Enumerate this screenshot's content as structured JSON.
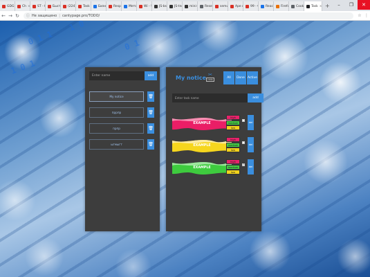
{
  "browser": {
    "tabs": [
      {
        "title": "GDG G",
        "color": "#d93025"
      },
      {
        "title": "Ch",
        "color": "#d93025"
      },
      {
        "title": "ST - fb",
        "color": "#d93025"
      },
      {
        "title": "Быстр",
        "color": "#d93025"
      },
      {
        "title": "(224) Н",
        "color": "#d93025"
      },
      {
        "title": "Task G",
        "color": "#d93025"
      },
      {
        "title": "Бизнес",
        "color": "#1a73e8"
      },
      {
        "title": "Respon",
        "color": "#d93025"
      },
      {
        "title": "Метод",
        "color": "#1a73e8"
      },
      {
        "title": "Wi - Sc",
        "color": "#d93025"
      },
      {
        "title": "JS-bsi",
        "color": "#333333"
      },
      {
        "title": "JS-tnd",
        "color": "#333333"
      },
      {
        "title": "mini-h",
        "color": "#333333"
      },
      {
        "title": "Reset",
        "color": "#5f6368"
      },
      {
        "title": "semun",
        "color": "#d93025"
      },
      {
        "title": "Аре в",
        "color": "#d93025"
      },
      {
        "title": "99 - Gi",
        "color": "#d93025"
      },
      {
        "title": "React",
        "color": "#1a73e8"
      },
      {
        "title": "Firefo",
        "color": "#e8710a"
      },
      {
        "title": "Cookie",
        "color": "#5f6368"
      },
      {
        "title": "Task",
        "color": "#202124"
      }
    ],
    "new_tab": "+",
    "window_controls": [
      "–",
      "❐",
      "✕"
    ],
    "nav": [
      "←",
      "→",
      "↻"
    ],
    "lock_text": "Не защищено",
    "url": "cantypage.pro/TODO/"
  },
  "app": {
    "left": {
      "input_placeholder": "Enter name",
      "add_label": "add",
      "notices": [
        {
          "label": "My notice",
          "selected": true
        },
        {
          "label": "пррпр",
          "selected": false
        },
        {
          "label": "прпр",
          "selected": false
        },
        {
          "label": "ыгмыгт",
          "selected": false
        }
      ],
      "trash_icon": "🗑"
    },
    "right": {
      "title": "My notice",
      "icon_symbol": "✂",
      "icon_label": "redo",
      "filters": [
        "All",
        "Done",
        "Active"
      ],
      "input_placeholder": "Enter task name",
      "add_label": "add",
      "priority_labels": {
        "high": "high",
        "medium": "medium",
        "low": "low"
      },
      "delete_label": "del",
      "tasks": [
        {
          "label": "EXAMPLE",
          "color": "#ea1e66",
          "wave": "#f58fb2",
          "checked": false
        },
        {
          "label": "EXAMPLE",
          "color": "#f6d61e",
          "wave": "#fbeaa0",
          "checked": false
        },
        {
          "label": "EXAMPLE",
          "color": "#3ecb3e",
          "wave": "#9ee69e",
          "checked": true
        }
      ]
    }
  },
  "colors": {
    "accent": "#3a8ede",
    "panel": "#3d3d3d",
    "input": "#2c2c2c"
  }
}
